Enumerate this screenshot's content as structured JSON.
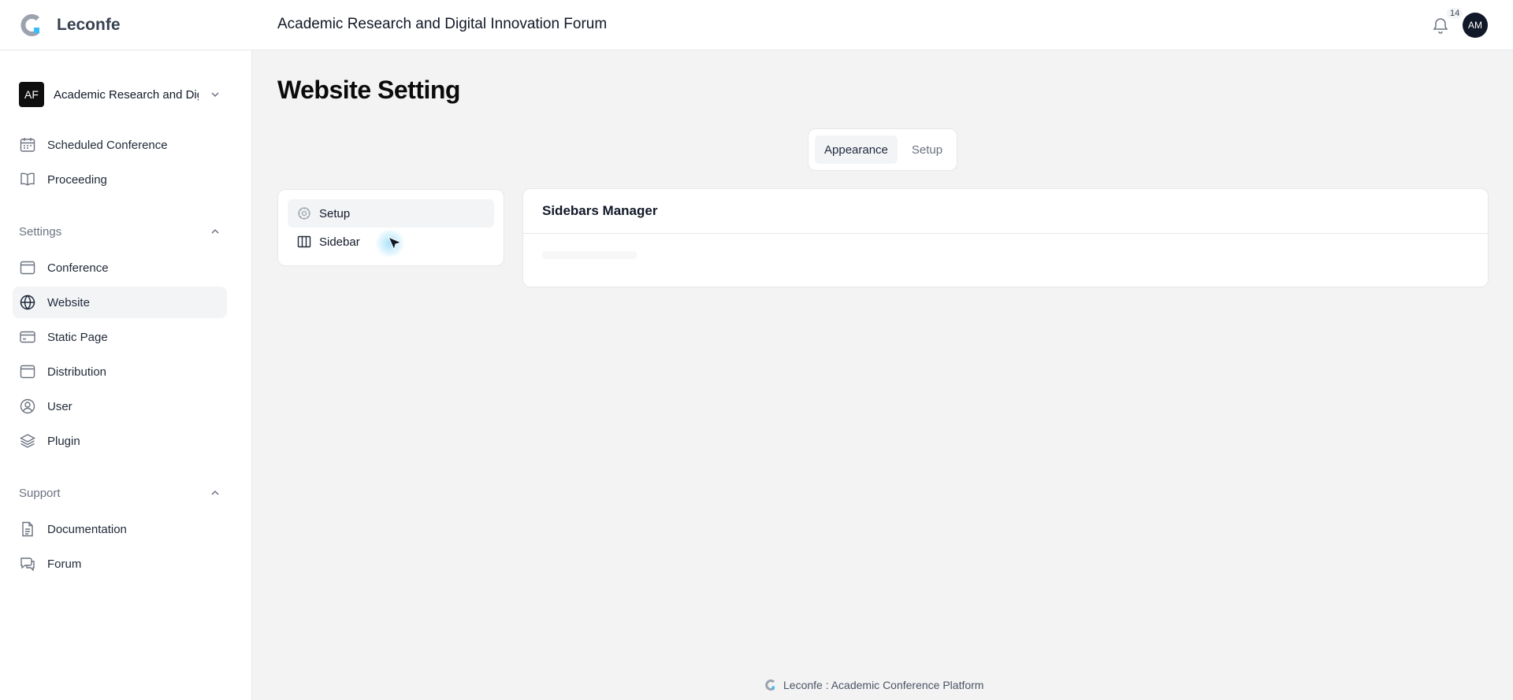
{
  "app": {
    "brand": "Leconfe",
    "header_title": "Academic Research and Digital Innovation Forum",
    "notification_count": "14",
    "user_initials": "AM",
    "accent_color": "#38bdf8"
  },
  "sidebar": {
    "conference_switcher": {
      "badge": "AF",
      "name": "Academic Research and Digital Innovation Forum"
    },
    "top_items": [
      {
        "label": "Scheduled Conference",
        "icon": "calendar-icon"
      },
      {
        "label": "Proceeding",
        "icon": "book-open-icon"
      }
    ],
    "settings_group": {
      "label": "Settings",
      "items": [
        {
          "label": "Conference",
          "icon": "browser-window-icon"
        },
        {
          "label": "Website",
          "icon": "globe-icon",
          "active": true
        },
        {
          "label": "Static Page",
          "icon": "card-icon"
        },
        {
          "label": "Distribution",
          "icon": "window-icon"
        },
        {
          "label": "User",
          "icon": "user-circle-icon"
        },
        {
          "label": "Plugin",
          "icon": "layers-icon"
        }
      ]
    },
    "support_group": {
      "label": "Support",
      "items": [
        {
          "label": "Documentation",
          "icon": "document-icon"
        },
        {
          "label": "Forum",
          "icon": "chat-bubbles-icon"
        }
      ]
    }
  },
  "main": {
    "page_title": "Website Setting",
    "tabs": [
      {
        "label": "Appearance",
        "active": true
      },
      {
        "label": "Setup",
        "active": false
      }
    ],
    "sub_nav": [
      {
        "label": "Setup",
        "icon": "cog-icon",
        "active": true
      },
      {
        "label": "Sidebar",
        "icon": "columns-icon",
        "active": false
      }
    ],
    "card": {
      "title": "Sidebars Manager"
    }
  },
  "footer": {
    "text": "Leconfe : Academic Conference Platform"
  }
}
